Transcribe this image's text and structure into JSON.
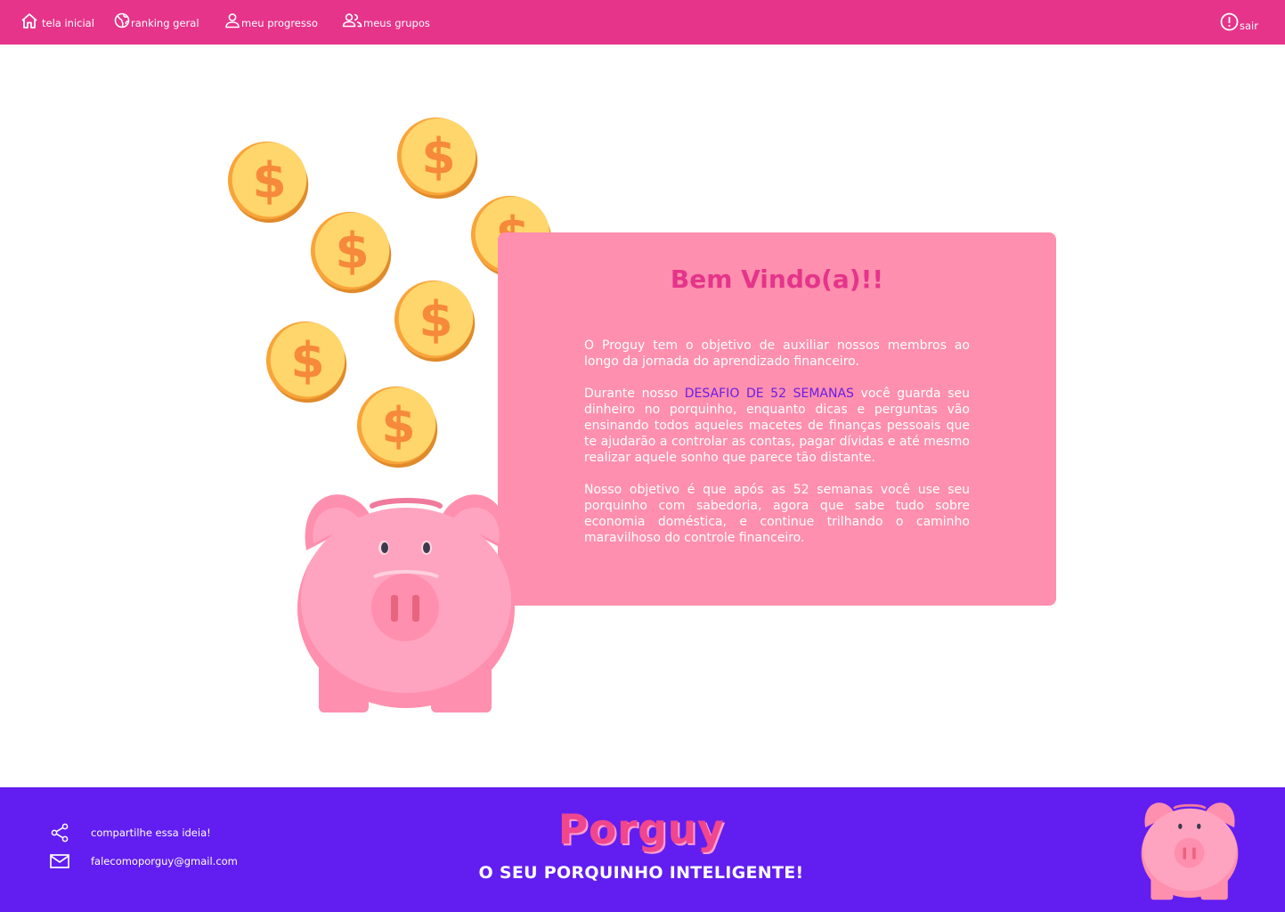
{
  "nav": {
    "items": [
      {
        "label": "tela inicial",
        "icon": "home-icon"
      },
      {
        "label": "ranking geral",
        "icon": "globe-icon"
      },
      {
        "label": "meu progresso",
        "icon": "person-icon"
      },
      {
        "label": "meus grupos",
        "icon": "group-icon"
      }
    ],
    "logout": {
      "label": "sair",
      "icon": "alert-circle-icon"
    }
  },
  "welcome": {
    "title": "Bem Vindo(a)!!",
    "paragraph1": "O Proguy tem o objetivo de auxiliar nossos membros ao longo  da jornada do aprendizado financeiro.",
    "paragraph2_prefix": "Durante nosso ",
    "paragraph2_highlight": "DESAFIO DE 52 SEMANAS",
    "paragraph2_suffix": "  você guarda seu dinheiro no porquinho,  enquanto dicas e perguntas vão ensinando todos aqueles macetes de finanças pessoais que te ajudarão a controlar as contas, pagar dívidas e até mesmo realizar aquele sonho que parece tão distante.",
    "paragraph3": "Nosso objetivo é que após as 52 semanas você use seu porquinho com sabedoria, agora que sabe tudo sobre economia doméstica, e continue trilhando o caminho maravilhoso do controle financeiro."
  },
  "footer": {
    "share_label": "compartilhe essa ideia!",
    "email_label": "falecomoporguy@gmail.com",
    "brand_name": "Porguy",
    "tagline": "O SEU PORQUINHO INTELIGENTE!"
  },
  "colors": {
    "topbar": "#e5348a",
    "card": "#ff8fae",
    "footer": "#621ef0",
    "highlight": "#6a1ee5",
    "coin": "#ffd66b",
    "pig": "#ffa4c0"
  }
}
